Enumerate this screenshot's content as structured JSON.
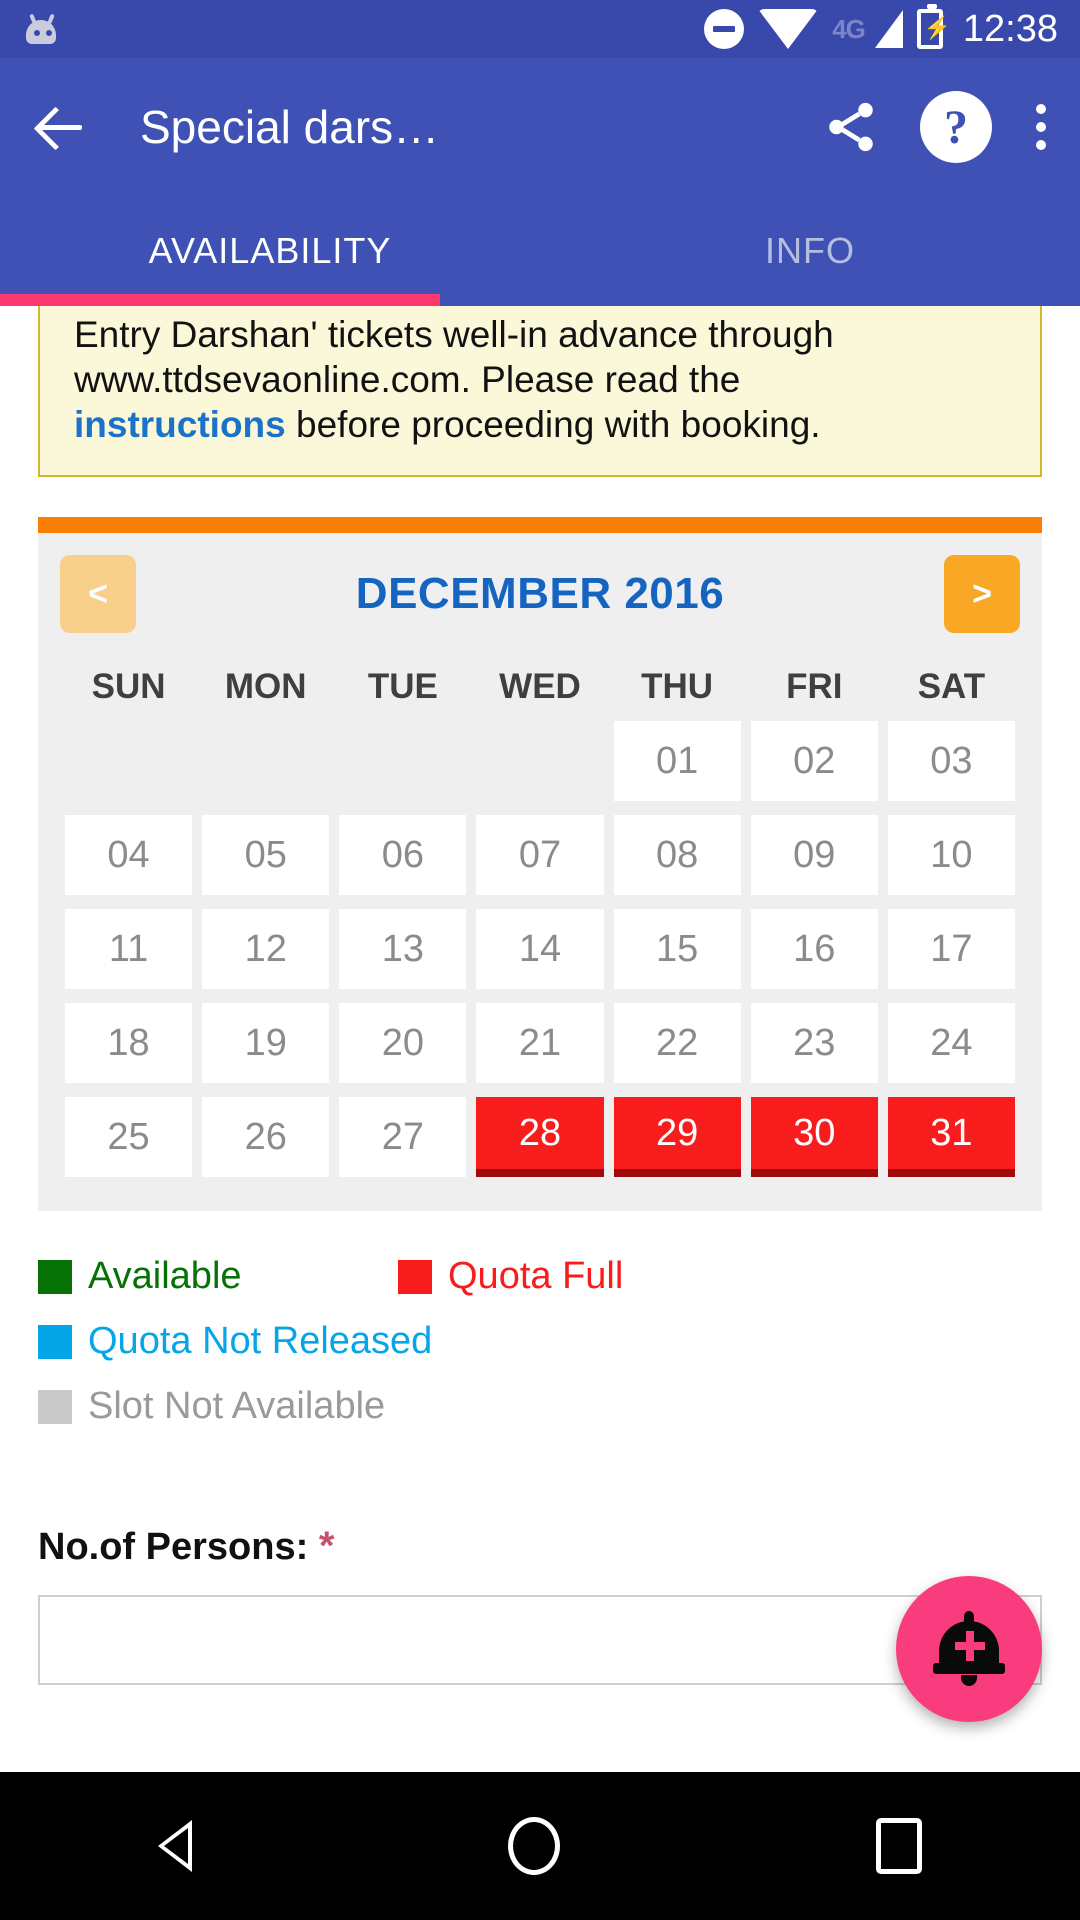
{
  "status_bar": {
    "time": "12:38",
    "network": "4G",
    "icons": [
      "android-head-icon",
      "do-not-disturb-icon",
      "wifi-icon",
      "signal-icon",
      "battery-charging-icon"
    ]
  },
  "app_bar": {
    "title": "Special dars…",
    "back_icon": "back-arrow-icon",
    "share_icon": "share-icon",
    "help_icon": "help-icon",
    "overflow_icon": "more-vert-icon"
  },
  "tabs": [
    {
      "label": "AVAILABILITY",
      "active": true
    },
    {
      "label": "INFO",
      "active": false
    }
  ],
  "notice": {
    "line1": "Entry Darshan' tickets well-in advance through",
    "line2": "www.ttdsevaonline.com. Please read the",
    "link": "instructions",
    "line3_rest": " before proceeding with booking."
  },
  "calendar": {
    "month_label": "DECEMBER 2016",
    "prev_label": "<",
    "next_label": ">",
    "weekdays": [
      "SUN",
      "MON",
      "TUE",
      "WED",
      "THU",
      "FRI",
      "SAT"
    ],
    "weeks": [
      [
        {
          "day": "",
          "state": "empty"
        },
        {
          "day": "",
          "state": "empty"
        },
        {
          "day": "",
          "state": "empty"
        },
        {
          "day": "",
          "state": "empty"
        },
        {
          "day": "01",
          "state": "slot-not-available"
        },
        {
          "day": "02",
          "state": "slot-not-available"
        },
        {
          "day": "03",
          "state": "slot-not-available"
        }
      ],
      [
        {
          "day": "04",
          "state": "slot-not-available"
        },
        {
          "day": "05",
          "state": "slot-not-available"
        },
        {
          "day": "06",
          "state": "slot-not-available"
        },
        {
          "day": "07",
          "state": "slot-not-available"
        },
        {
          "day": "08",
          "state": "slot-not-available"
        },
        {
          "day": "09",
          "state": "slot-not-available"
        },
        {
          "day": "10",
          "state": "slot-not-available"
        }
      ],
      [
        {
          "day": "11",
          "state": "slot-not-available"
        },
        {
          "day": "12",
          "state": "slot-not-available"
        },
        {
          "day": "13",
          "state": "slot-not-available"
        },
        {
          "day": "14",
          "state": "slot-not-available"
        },
        {
          "day": "15",
          "state": "slot-not-available"
        },
        {
          "day": "16",
          "state": "slot-not-available"
        },
        {
          "day": "17",
          "state": "slot-not-available"
        }
      ],
      [
        {
          "day": "18",
          "state": "slot-not-available"
        },
        {
          "day": "19",
          "state": "slot-not-available"
        },
        {
          "day": "20",
          "state": "slot-not-available"
        },
        {
          "day": "21",
          "state": "slot-not-available"
        },
        {
          "day": "22",
          "state": "slot-not-available"
        },
        {
          "day": "23",
          "state": "slot-not-available"
        },
        {
          "day": "24",
          "state": "slot-not-available"
        }
      ],
      [
        {
          "day": "25",
          "state": "slot-not-available"
        },
        {
          "day": "26",
          "state": "slot-not-available"
        },
        {
          "day": "27",
          "state": "slot-not-available"
        },
        {
          "day": "28",
          "state": "quota-full"
        },
        {
          "day": "29",
          "state": "quota-full"
        },
        {
          "day": "30",
          "state": "quota-full"
        },
        {
          "day": "31",
          "state": "quota-full"
        }
      ]
    ]
  },
  "legend": [
    {
      "label": "Available",
      "color": "#067206"
    },
    {
      "label": "Quota Full",
      "color": "#f91c1c"
    },
    {
      "label": "Quota Not Released",
      "color": "#04a6e8"
    },
    {
      "label": "Slot Not Available",
      "color": "#c9c9c9"
    }
  ],
  "form": {
    "persons_label": "No.of Persons:",
    "required_mark": "*",
    "persons_value": ""
  },
  "fab": {
    "icon": "add-alert-bell-icon",
    "color": "#f93c7e"
  },
  "nav_bar": {
    "back": "nav-back-icon",
    "home": "nav-home-icon",
    "recents": "nav-recents-icon"
  },
  "colors": {
    "status_bar": "#3949ab",
    "app_bar": "#3f51b5",
    "tab_indicator": "#f8386e",
    "calendar_topbar": "#f97e05",
    "month_text": "#1565c0",
    "notice_bg": "#fbf8da",
    "notice_border": "#d4b92e",
    "link": "#1a73c8"
  }
}
